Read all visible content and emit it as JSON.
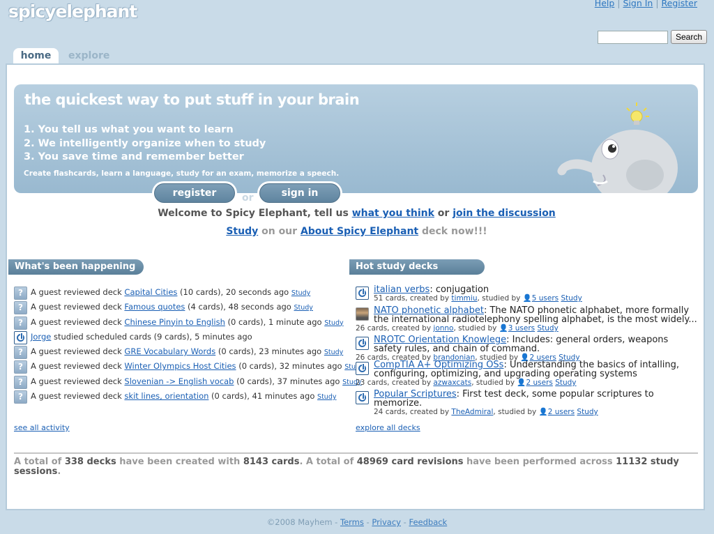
{
  "brand": {
    "logo_text": "spicyelephant"
  },
  "toplinks": {
    "help": "Help",
    "sep1": "|",
    "signin": "Sign In",
    "sep2": "|",
    "register": "Register"
  },
  "search": {
    "value": "",
    "button": "Search"
  },
  "tabs": [
    {
      "label": "home",
      "active": true
    },
    {
      "label": "explore",
      "active": false
    }
  ],
  "hero": {
    "title": "the quickest way to put stuff in your brain",
    "steps": [
      "1. You tell us what you want to learn",
      "2. We intelligently organize when to study",
      "3. You save time and remember better"
    ],
    "subtitle": "Create flashcards, learn a language, study for an exam, memorize a speech.",
    "register_label": "register",
    "or_label": "or",
    "signin_label": "sign in"
  },
  "welcome": {
    "text1": "Welcome to Spicy Elephant, tell us ",
    "link1": "what you think",
    "text2": " or ",
    "link2": "join the discussion",
    "study_link": "Study",
    "text3": " on our ",
    "deck_link": "About Spicy Elephant",
    "text4": " deck now!!!"
  },
  "activity": {
    "header": "What's been happening",
    "items": [
      {
        "icon": "question-icon",
        "actor": "A guest",
        "verb": " reviewed deck ",
        "deck": "Capital Cities",
        "detail": " (10 cards), 20 seconds ago ",
        "study": "Study"
      },
      {
        "icon": "question-icon",
        "actor": "A guest",
        "verb": " reviewed deck ",
        "deck": "Famous quotes",
        "detail": " (4 cards), 48 seconds ago ",
        "study": "Study"
      },
      {
        "icon": "question-icon",
        "actor": "A guest",
        "verb": " reviewed deck ",
        "deck": "Chinese Pinyin to English",
        "detail": " (0 cards), 1 minute ago ",
        "study": "Study"
      },
      {
        "icon": "power-icon",
        "actor": "Jorge",
        "verb": " studied scheduled cards ",
        "deck": "",
        "detail": "(9 cards), 5 minutes ago",
        "study": ""
      },
      {
        "icon": "question-icon",
        "actor": "A guest",
        "verb": " reviewed deck ",
        "deck": "GRE Vocabulary Words",
        "detail": " (0 cards), 23 minutes ago ",
        "study": "Study"
      },
      {
        "icon": "question-icon",
        "actor": "A guest",
        "verb": " reviewed deck ",
        "deck": "Winter Olympics Host Cities",
        "detail": " (0 cards), 32 minutes ago ",
        "study": "Study"
      },
      {
        "icon": "question-icon",
        "actor": "A guest",
        "verb": " reviewed deck ",
        "deck": "Slovenian -> English vocab",
        "detail": " (0 cards), 37 minutes ago ",
        "study": "Study"
      },
      {
        "icon": "question-icon",
        "actor": "A guest",
        "verb": " reviewed deck ",
        "deck": "skit lines, orientation",
        "detail": " (0 cards), 41 minutes ago ",
        "study": "Study"
      }
    ],
    "see_all": "see all activity"
  },
  "hot_decks": {
    "header": "Hot study decks",
    "items": [
      {
        "icon": "power-icon",
        "name": "italian verbs",
        "desc": ": conjugation",
        "cards": "51 cards, created by ",
        "creator": "timmiu",
        "studied": ", studied by ",
        "users": "5 users",
        "study": "Study"
      },
      {
        "icon": "photo-icon",
        "name": "NATO phonetic alphabet",
        "desc": ": The NATO phonetic alphabet, more formally the international radiotelephony spelling alphabet, is the most widely...",
        "cards": "26 cards, created by ",
        "creator": "jonno",
        "studied": ", studied by ",
        "users": "3 users",
        "study": "Study"
      },
      {
        "icon": "power-icon",
        "name": "NROTC Orientation Knowlege",
        "desc": ": Includes: general orders, weapons safety rules, and chain of command.",
        "cards": "26 cards, created by ",
        "creator": "brandonian",
        "studied": ", studied by ",
        "users": "2 users",
        "study": "Study"
      },
      {
        "icon": "power-icon",
        "name": "CompTIA A+ Optimizing OSs",
        "desc": ": Understanding the basics of intalling, configuring, optimizing, and upgrading operating systems",
        "cards": "23 cards, created by ",
        "creator": "azwaxcats",
        "studied": ", studied by ",
        "users": "2 users",
        "study": "Study"
      },
      {
        "icon": "power-icon",
        "name": "Popular Scriptures",
        "desc": ": First test deck, some popular scriptures to memorize.",
        "cards": "24 cards, created by ",
        "creator": "TheAdmiral",
        "studied": ", studied by ",
        "users": "2 users",
        "study": "Study"
      }
    ],
    "explore_all": "explore all decks"
  },
  "totals": {
    "t1": "A total of ",
    "decks": "338 decks",
    "t2": " have been created with ",
    "cards": "8143 cards",
    "t3": ". A total of ",
    "revisions": "48969 card revisions",
    "t4": " have been performed across ",
    "sessions": "11132 study sessions",
    "t5": "."
  },
  "footer": {
    "copyright": "©2008 Mayhem",
    "dash": " - ",
    "terms": "Terms",
    "privacy": "Privacy",
    "feedback": "Feedback"
  },
  "colors": {
    "page_bg": "#c9dbe8",
    "link": "#1a5fb4",
    "header_bar": "#5a7f99"
  }
}
